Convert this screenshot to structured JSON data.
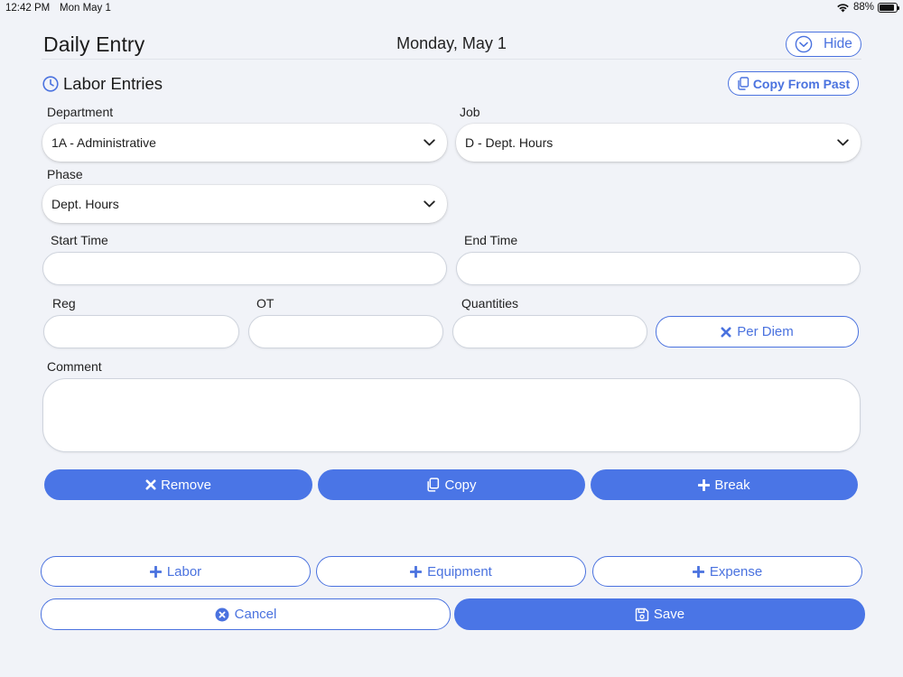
{
  "status_bar": {
    "time": "12:42 PM",
    "date": "Mon May 1",
    "battery": "88%"
  },
  "header": {
    "title": "Daily Entry",
    "date": "Monday, May 1",
    "hide_label": "Hide"
  },
  "section": {
    "title": "Labor Entries",
    "copy_from_past_label": "Copy From Past"
  },
  "form": {
    "department": {
      "label": "Department",
      "value": "1A - Administrative"
    },
    "job": {
      "label": "Job",
      "value": "D - Dept. Hours"
    },
    "phase": {
      "label": "Phase",
      "value": "Dept. Hours"
    },
    "start_time": {
      "label": "Start Time",
      "value": ""
    },
    "end_time": {
      "label": "End Time",
      "value": ""
    },
    "reg": {
      "label": "Reg",
      "value": ""
    },
    "ot": {
      "label": "OT",
      "value": ""
    },
    "quantities": {
      "label": "Quantities",
      "value": ""
    },
    "per_diem_label": "Per Diem",
    "comment": {
      "label": "Comment",
      "value": ""
    }
  },
  "entry_actions": {
    "remove": "Remove",
    "copy": "Copy",
    "break": "Break"
  },
  "add_actions": {
    "labor": "Labor",
    "equipment": "Equipment",
    "expense": "Expense"
  },
  "footer": {
    "cancel": "Cancel",
    "save": "Save"
  },
  "colors": {
    "accent": "#4a75e6",
    "background": "#f1f3f8"
  },
  "icons": {
    "clock": "clock-icon",
    "hide": "chevron-down-circle-icon",
    "copy": "copy-icon",
    "chevron": "chevron-down-icon",
    "x": "x-icon",
    "plus": "plus-icon",
    "cancel": "x-circle-icon",
    "save": "floppy-disk-icon"
  }
}
